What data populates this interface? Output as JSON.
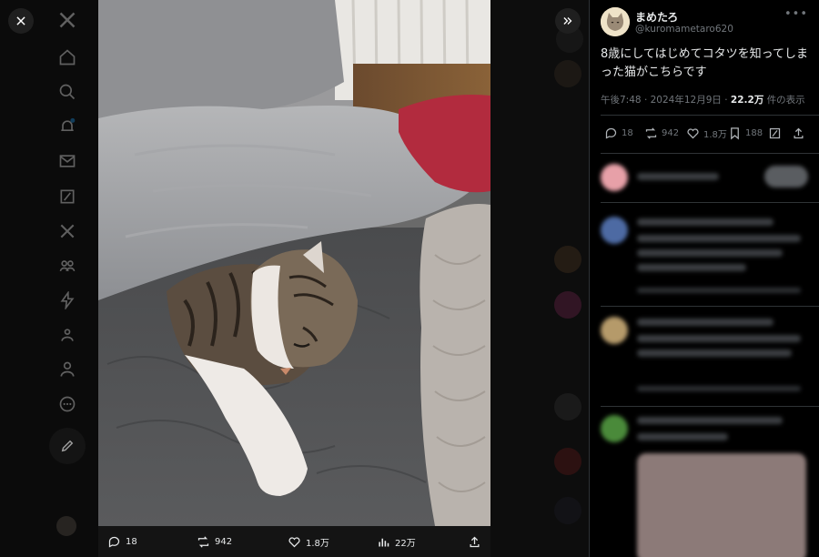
{
  "tweet": {
    "display_name": "まめたろ",
    "handle": "@kuromametaro620",
    "text": "8歳にしてはじめてコタツを知ってしまった猫がこちらです",
    "time": "午後7:48",
    "date": "2024年12月9日",
    "views": "22.2万",
    "views_label": "件の表示",
    "sep": "·"
  },
  "panel_actions": {
    "replies": "18",
    "retweets": "942",
    "likes": "1.8万",
    "bookmarks": "188"
  },
  "media_actions": {
    "replies": "18",
    "retweets": "942",
    "likes": "1.8万",
    "views": "22万"
  },
  "icons": [
    "close-icon",
    "expand-icon",
    "x-logo-icon",
    "home-icon",
    "search-icon",
    "notifications-icon",
    "messages-icon",
    "grok-icon",
    "premium-icon",
    "communities-icon",
    "bolt-icon",
    "people-icon",
    "profile-icon",
    "more-icon",
    "compose-icon",
    "reply-icon",
    "retweet-icon",
    "like-icon",
    "bookmark-icon",
    "grok-icon",
    "share-icon",
    "views-icon"
  ],
  "colors": {
    "accent": "#1d9bf0",
    "text": "#e7e9ea",
    "muted": "#71767b"
  }
}
